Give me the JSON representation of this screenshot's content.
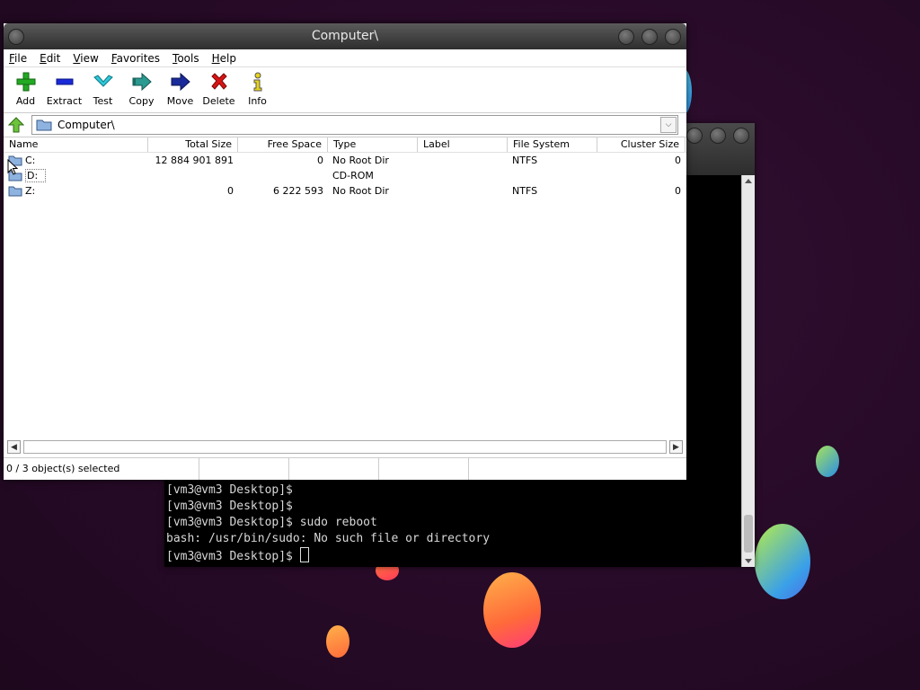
{
  "window": {
    "title": "Computer\\"
  },
  "menu": [
    "File",
    "Edit",
    "View",
    "Favorites",
    "Tools",
    "Help"
  ],
  "toolbar": [
    {
      "label": "Add",
      "icon": "plus-icon"
    },
    {
      "label": "Extract",
      "icon": "minus-icon"
    },
    {
      "label": "Test",
      "icon": "check-icon"
    },
    {
      "label": "Copy",
      "icon": "copy-arrow-icon"
    },
    {
      "label": "Move",
      "icon": "move-arrow-icon"
    },
    {
      "label": "Delete",
      "icon": "delete-x-icon"
    },
    {
      "label": "Info",
      "icon": "info-icon"
    }
  ],
  "address": {
    "path": "Computer\\"
  },
  "columns": [
    "Name",
    "Total Size",
    "Free Space",
    "Type",
    "Label",
    "File System",
    "Cluster Size"
  ],
  "rows": [
    {
      "name": "C:",
      "total": "12 884 901 891",
      "free": "0",
      "type": "No Root Dir",
      "label": "",
      "fs": "NTFS",
      "cluster": "0"
    },
    {
      "name": "D:",
      "total": "",
      "free": "",
      "type": "CD-ROM",
      "label": "",
      "fs": "",
      "cluster": ""
    },
    {
      "name": "Z:",
      "total": "0",
      "free": "6 222 593",
      "type": "No Root Dir",
      "label": "",
      "fs": "NTFS",
      "cluster": "0"
    }
  ],
  "status": {
    "selected": "0 / 3 object(s) selected"
  },
  "terminal": {
    "lines": [
      "[vm3@vm3 Desktop]$",
      "[vm3@vm3 Desktop]$",
      "[vm3@vm3 Desktop]$ sudo reboot",
      "bash: /usr/bin/sudo: No such file or directory",
      "[vm3@vm3 Desktop]$ "
    ]
  },
  "colors": {
    "desktop": "#2a0d2a",
    "accent_green": "#22aa22",
    "accent_red": "#cc1111"
  }
}
